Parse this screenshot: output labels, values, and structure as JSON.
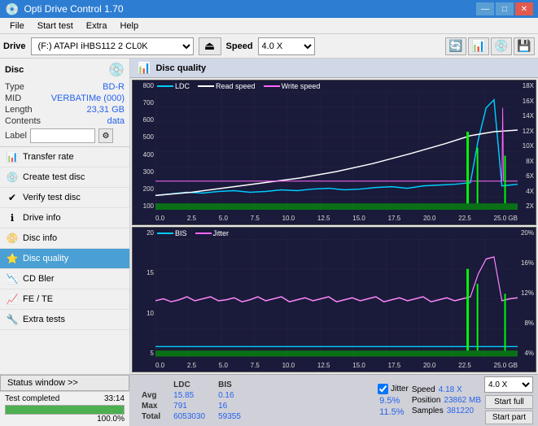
{
  "titlebar": {
    "title": "Opti Drive Control 1.70",
    "minimize": "—",
    "maximize": "□",
    "close": "✕"
  },
  "menubar": {
    "items": [
      "File",
      "Start test",
      "Extra",
      "Help"
    ]
  },
  "drivebar": {
    "drive_label": "Drive",
    "drive_value": "(F:)  ATAPI iHBS112  2 CL0K",
    "speed_label": "Speed",
    "speed_value": "4.0 X"
  },
  "disc": {
    "title": "Disc",
    "type_label": "Type",
    "type_value": "BD-R",
    "mid_label": "MID",
    "mid_value": "VERBATIMe (000)",
    "length_label": "Length",
    "length_value": "23,31 GB",
    "contents_label": "Contents",
    "contents_value": "data",
    "label_label": "Label",
    "label_placeholder": ""
  },
  "nav": {
    "items": [
      {
        "id": "transfer-rate",
        "label": "Transfer rate",
        "icon": "📊"
      },
      {
        "id": "create-test-disc",
        "label": "Create test disc",
        "icon": "💿"
      },
      {
        "id": "verify-test-disc",
        "label": "Verify test disc",
        "icon": "✔"
      },
      {
        "id": "drive-info",
        "label": "Drive info",
        "icon": "ℹ"
      },
      {
        "id": "disc-info",
        "label": "Disc info",
        "icon": "📀"
      },
      {
        "id": "disc-quality",
        "label": "Disc quality",
        "icon": "⭐",
        "active": true
      },
      {
        "id": "cd-bler",
        "label": "CD Bler",
        "icon": "📉"
      },
      {
        "id": "fe-te",
        "label": "FE / TE",
        "icon": "📈"
      },
      {
        "id": "extra-tests",
        "label": "Extra tests",
        "icon": "🔧"
      }
    ]
  },
  "status": {
    "button_label": "Status window >>",
    "progress_pct": 100,
    "status_text": "Test completed",
    "time": "33:14"
  },
  "content": {
    "header": "Disc quality",
    "legend": {
      "ldc": "LDC",
      "read_speed": "Read speed",
      "write_speed": "Write speed",
      "bis": "BIS",
      "jitter": "Jitter"
    },
    "top_chart": {
      "y_right": [
        "18X",
        "16X",
        "14X",
        "12X",
        "10X",
        "8X",
        "6X",
        "4X",
        "2X"
      ],
      "y_left": [
        "800",
        "700",
        "600",
        "500",
        "400",
        "300",
        "200",
        "100"
      ],
      "x": [
        "0.0",
        "2.5",
        "5.0",
        "7.5",
        "10.0",
        "12.5",
        "15.0",
        "17.5",
        "20.0",
        "22.5",
        "25.0 GB"
      ]
    },
    "bottom_chart": {
      "y_right": [
        "20%",
        "16%",
        "12%",
        "8%",
        "4%"
      ],
      "y_left": [
        "20",
        "15",
        "10",
        "5"
      ],
      "x": [
        "0.0",
        "2.5",
        "5.0",
        "7.5",
        "10.0",
        "12.5",
        "15.0",
        "17.5",
        "20.0",
        "22.5",
        "25.0 GB"
      ]
    }
  },
  "stats": {
    "columns": [
      "",
      "LDC",
      "BIS",
      "",
      "Jitter",
      "Speed",
      "4.18 X"
    ],
    "avg_label": "Avg",
    "avg_ldc": "15.85",
    "avg_bis": "0.16",
    "avg_jitter": "9.5%",
    "max_label": "Max",
    "max_ldc": "791",
    "max_bis": "16",
    "max_jitter": "11.5%",
    "total_label": "Total",
    "total_ldc": "6053030",
    "total_bis": "59355",
    "position_label": "Position",
    "position_value": "23862 MB",
    "samples_label": "Samples",
    "samples_value": "381220",
    "speed_select": "4.0 X",
    "start_full": "Start full",
    "start_part": "Start part",
    "jitter_checked": true,
    "jitter_label": "Jitter"
  }
}
